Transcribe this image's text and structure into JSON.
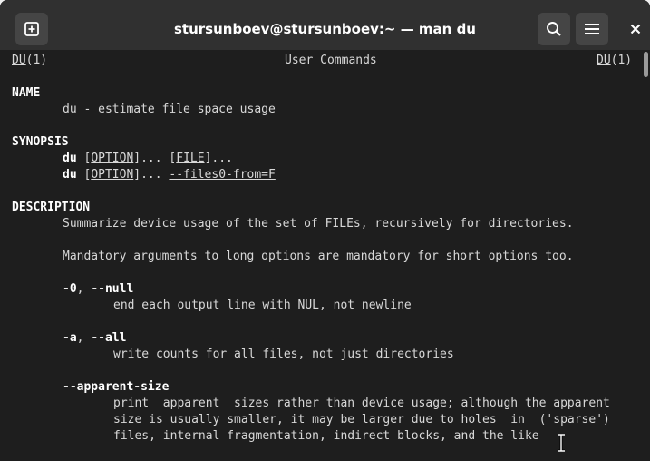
{
  "window": {
    "title": "stursunboev@stursunboev:~ — man du"
  },
  "icons": {
    "new_tab": "new-tab-icon",
    "search": "search-icon",
    "menu": "hamburger-menu-icon",
    "close": "close-icon",
    "cursor": "text-cursor-icon"
  },
  "colors": {
    "terminal_bg": "#1e1e1e",
    "titlebar_bg": "#303030",
    "text": "#d8d8d8",
    "bold_text": "#ffffff"
  },
  "man": {
    "header": {
      "left_name": "DU",
      "left_section": "(1)",
      "center": "User Commands",
      "right_name": "DU",
      "right_section": "(1)"
    },
    "name_heading": "NAME",
    "name_line": "du - estimate file space usage",
    "synopsis_heading": "SYNOPSIS",
    "synopsis1": {
      "cmd": "du",
      "sp1": " ",
      "lb1": "[",
      "opt": "OPTION",
      "rb1": "]",
      "dots1": "... ",
      "lb2": "[",
      "file": "FILE",
      "rb2": "]",
      "dots2": "..."
    },
    "synopsis2": {
      "cmd": "du",
      "sp1": " ",
      "lb1": "[",
      "opt": "OPTION",
      "rb1": "]",
      "dots1": "... ",
      "files0": "--files0-from=F"
    },
    "description_heading": "DESCRIPTION",
    "desc1": "Summarize device usage of the set of FILEs, recursively for directories.",
    "desc2": "Mandatory arguments to long options are mandatory for short options too.",
    "opt_null": {
      "short": "-0",
      "sep": ", ",
      "long": "--null",
      "desc": "end each output line with NUL, not newline"
    },
    "opt_all": {
      "short": "-a",
      "sep": ", ",
      "long": "--all",
      "desc": "write counts for all files, not just directories"
    },
    "opt_apparent": {
      "long": "--apparent-size",
      "desc1": "print  apparent  sizes rather than device usage; although the apparent",
      "desc2": "size is usually smaller, it may be larger due to holes  in  ('sparse')",
      "desc3": "files, internal fragmentation, indirect blocks, and the like"
    }
  }
}
